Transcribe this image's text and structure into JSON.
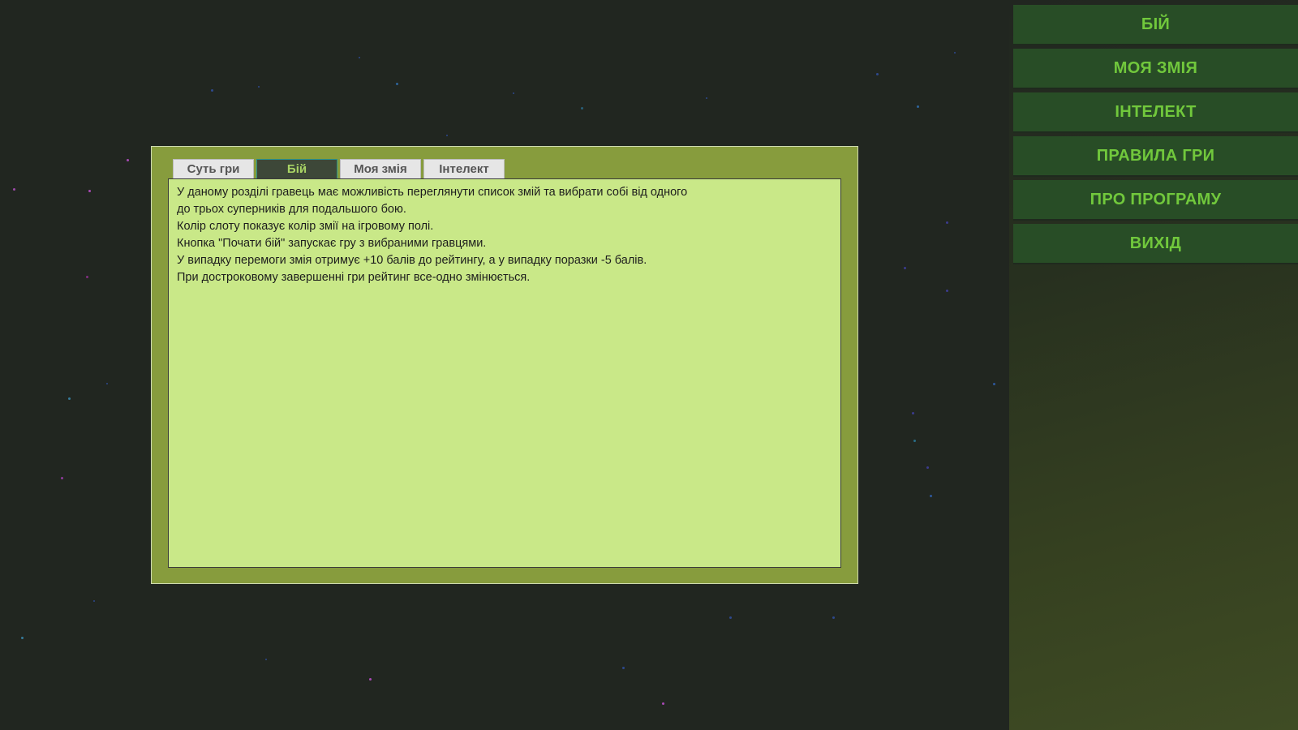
{
  "menu": {
    "items": [
      {
        "label": "БІЙ"
      },
      {
        "label": "МОЯ ЗМІЯ"
      },
      {
        "label": "ІНТЕЛЕКТ"
      },
      {
        "label": "ПРАВИЛА ГРИ"
      },
      {
        "label": "ПРО ПРОГРАМУ"
      },
      {
        "label": "ВИХІД"
      }
    ]
  },
  "rules_window": {
    "tabs": [
      {
        "label": "Суть гри",
        "active": false
      },
      {
        "label": "Бій",
        "active": true
      },
      {
        "label": "Моя змія",
        "active": false
      },
      {
        "label": "Інтелект",
        "active": false
      }
    ],
    "content_lines": [
      "У даному розділі гравець має можливість переглянути список змій та вибрати собі від одного",
      "до трьох суперників для подальшого бою.",
      "Колір слоту показує колір змії на ігровому полі.",
      "Кнопка \"Почати бій\" запускає гру з вибраними гравцями.",
      "У випадку перемоги змія отримує +10 балів до рейтингу, а у випадку поразки -5 балів.",
      "При достроковому завершенні гри рейтинг все-одно змінюється."
    ]
  },
  "colors": {
    "background": "#212620",
    "menu_button_bg": "#284d26",
    "menu_text": "#71c83c",
    "window_frame": "#879c3d",
    "content_bg": "#c9e888",
    "active_tab_bg": "#3d4738",
    "active_tab_text": "#a9d465"
  }
}
